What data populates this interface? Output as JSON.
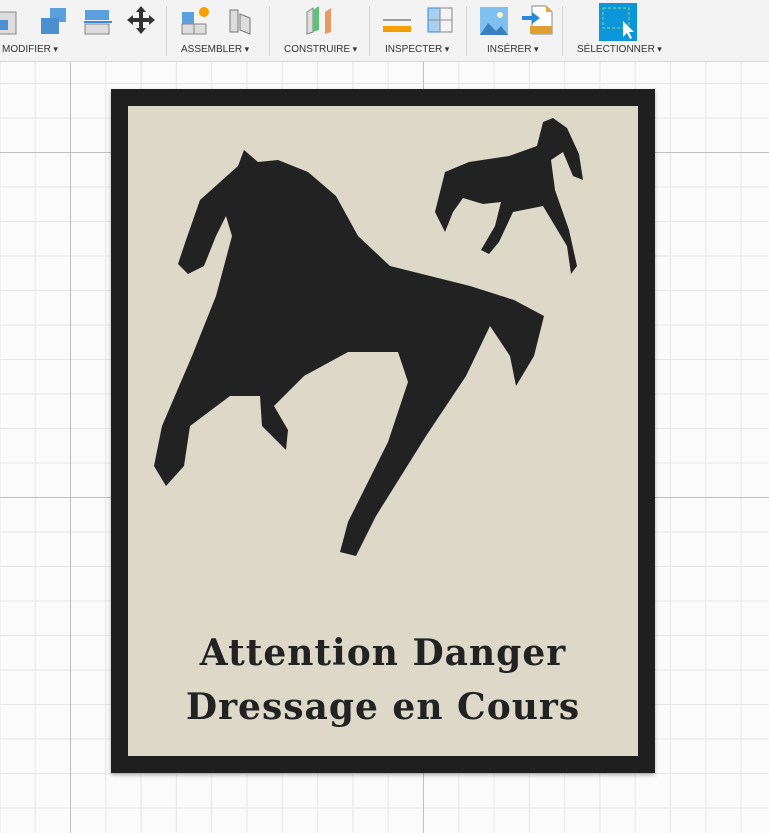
{
  "toolbar": {
    "groups": [
      {
        "label": "MODIFIER",
        "icons": [
          "press-pull-icon",
          "combine-icon",
          "split-body-icon",
          "move-icon"
        ]
      },
      {
        "label": "ASSEMBLER",
        "icons": [
          "new-component-icon",
          "joint-icon"
        ]
      },
      {
        "label": "CONSTRUIRE",
        "icons": [
          "offset-plane-icon"
        ]
      },
      {
        "label": "INSPECTER",
        "icons": [
          "measure-icon",
          "section-analysis-icon"
        ]
      },
      {
        "label": "INSÉRER",
        "icons": [
          "insert-image-icon",
          "insert-svg-icon"
        ]
      },
      {
        "label": "SÉLECTIONNER",
        "icons": [
          "window-select-icon"
        ]
      }
    ]
  },
  "plaque": {
    "line1": "Attention Danger",
    "line2": "Dressage en Cours",
    "frame_color": "#1f1f1f",
    "panel_color": "#ddd8c8"
  }
}
